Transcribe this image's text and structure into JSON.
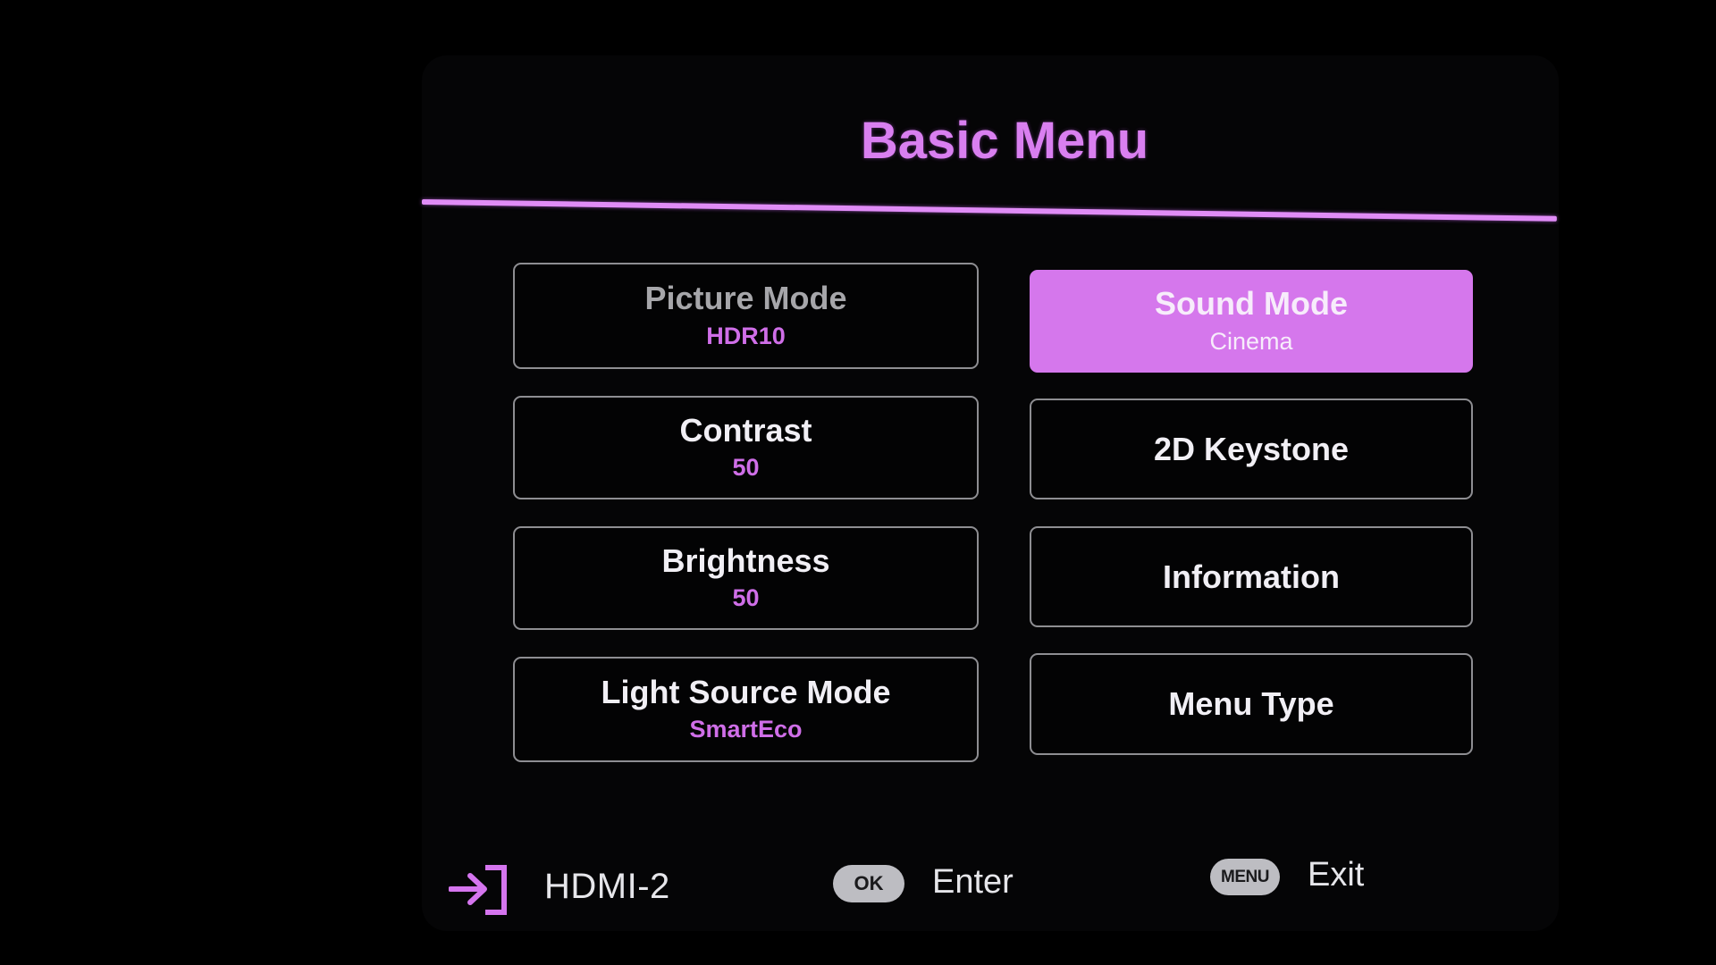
{
  "header": {
    "title": "Basic Menu"
  },
  "colors": {
    "accent": "#d97ff0",
    "selected_tile": "#d577ec",
    "value_text": "#cf6ee8",
    "tile_border": "#8e8e92",
    "background": "#000000"
  },
  "menu": {
    "items": [
      {
        "label": "Picture Mode",
        "value": "HDR10",
        "state": "disabled"
      },
      {
        "label": "Sound Mode",
        "value": "Cinema",
        "state": "selected"
      },
      {
        "label": "Contrast",
        "value": "50",
        "state": "normal"
      },
      {
        "label": "2D Keystone",
        "value": null,
        "state": "normal"
      },
      {
        "label": "Brightness",
        "value": "50",
        "state": "normal"
      },
      {
        "label": "Information",
        "value": null,
        "state": "normal"
      },
      {
        "label": "Light Source Mode",
        "value": "SmartEco",
        "state": "normal"
      },
      {
        "label": "Menu Type",
        "value": null,
        "state": "normal"
      }
    ]
  },
  "footer": {
    "source_icon": "input-source-icon",
    "source": "HDMI-2",
    "ok_key": "OK",
    "ok_action": "Enter",
    "menu_key": "MENU",
    "menu_action": "Exit"
  }
}
